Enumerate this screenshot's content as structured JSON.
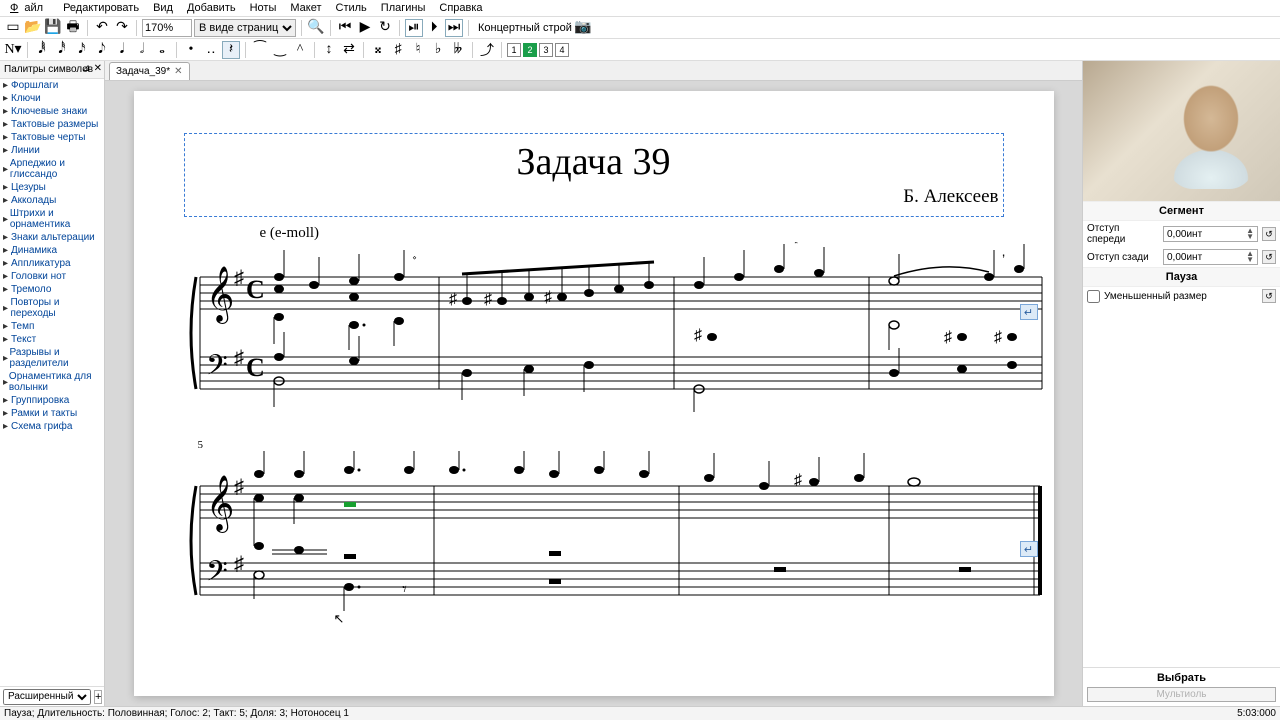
{
  "menu": {
    "file": "Файл",
    "edit": "Редактировать",
    "view": "Вид",
    "add": "Добавить",
    "notes": "Ноты",
    "layout": "Макет",
    "style": "Стиль",
    "plugins": "Плагины",
    "help": "Справка"
  },
  "toolbar": {
    "zoom": "170%",
    "view_mode": "В виде страниц",
    "concert_pitch": "Концертный строй",
    "voices": [
      "1",
      "2",
      "3",
      "4"
    ],
    "active_voice": 2
  },
  "palette": {
    "title": "Палитры символов",
    "items": [
      "Форшлаги",
      "Ключи",
      "Ключевые знаки",
      "Тактовые размеры",
      "Тактовые черты",
      "Линии",
      "Арпеджио и глиссандо",
      "Цезуры",
      "Акколады",
      "Штрихи и орнаментика",
      "Знаки альтерации",
      "Динамика",
      "Аппликатура",
      "Головки нот",
      "Тремоло",
      "Повторы и переходы",
      "Темп",
      "Текст",
      "Разрывы и разделители",
      "Орнаментика для волынки",
      "Группировка",
      "Рамки и такты",
      "Схема грифа"
    ],
    "workspace": "Расширенный"
  },
  "tab": {
    "name": "Задача_39*"
  },
  "score": {
    "title": "Задача 39",
    "composer": "Б. Алексеев",
    "tempo": "e (e-moll)",
    "measure_number": "5"
  },
  "inspector": {
    "section_segment": "Сегмент",
    "leading_label": "Отступ спереди",
    "leading_value": "0,00инт",
    "trailing_label": "Отступ сзади",
    "trailing_value": "0,00инт",
    "section_rest": "Пауза",
    "small_label": "Уменьшенный размер",
    "select_title": "Выбрать",
    "tuplet_btn": "Мультиоль"
  },
  "status": {
    "left": "Пауза; Длительность: Половинная; Голос: 2; Такт: 5; Доля: 3; Нотоносец 1",
    "right": "5:03:000"
  }
}
